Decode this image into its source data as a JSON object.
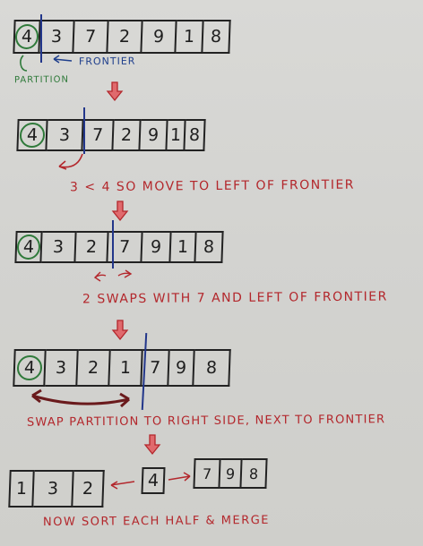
{
  "diagram": {
    "step1": {
      "cells": [
        "4",
        "3",
        "7",
        "2",
        "9",
        "1",
        "8"
      ],
      "partition_label": "PARTITION",
      "frontier_label": "FRONTIER"
    },
    "step2": {
      "cells": [
        "4",
        "3",
        "7",
        "2",
        "9",
        "1",
        "8"
      ],
      "note": "3 < 4  SO MOVE TO LEFT OF FRONTIER"
    },
    "step3": {
      "cells": [
        "4",
        "3",
        "2",
        "7",
        "9",
        "1",
        "8"
      ],
      "note": "2 SWAPS WITH 7 AND LEFT OF FRONTIER"
    },
    "step4": {
      "cells": [
        "4",
        "3",
        "2",
        "1",
        "7",
        "9",
        "8"
      ],
      "note": "SWAP PARTITION TO RIGHT SIDE, NEXT TO FRONTIER"
    },
    "step5": {
      "left": [
        "1",
        "3",
        "2"
      ],
      "pivot": "4",
      "right": [
        "7",
        "9",
        "8"
      ],
      "note": "NOW SORT EACH HALF & MERGE"
    },
    "colors": {
      "ink": "#1e1e1e",
      "annotation": "#b3272c",
      "pivot_circle": "#2f7a3a",
      "frontier_line": "#22368a",
      "arrow_fill": "#e06a6d"
    }
  }
}
